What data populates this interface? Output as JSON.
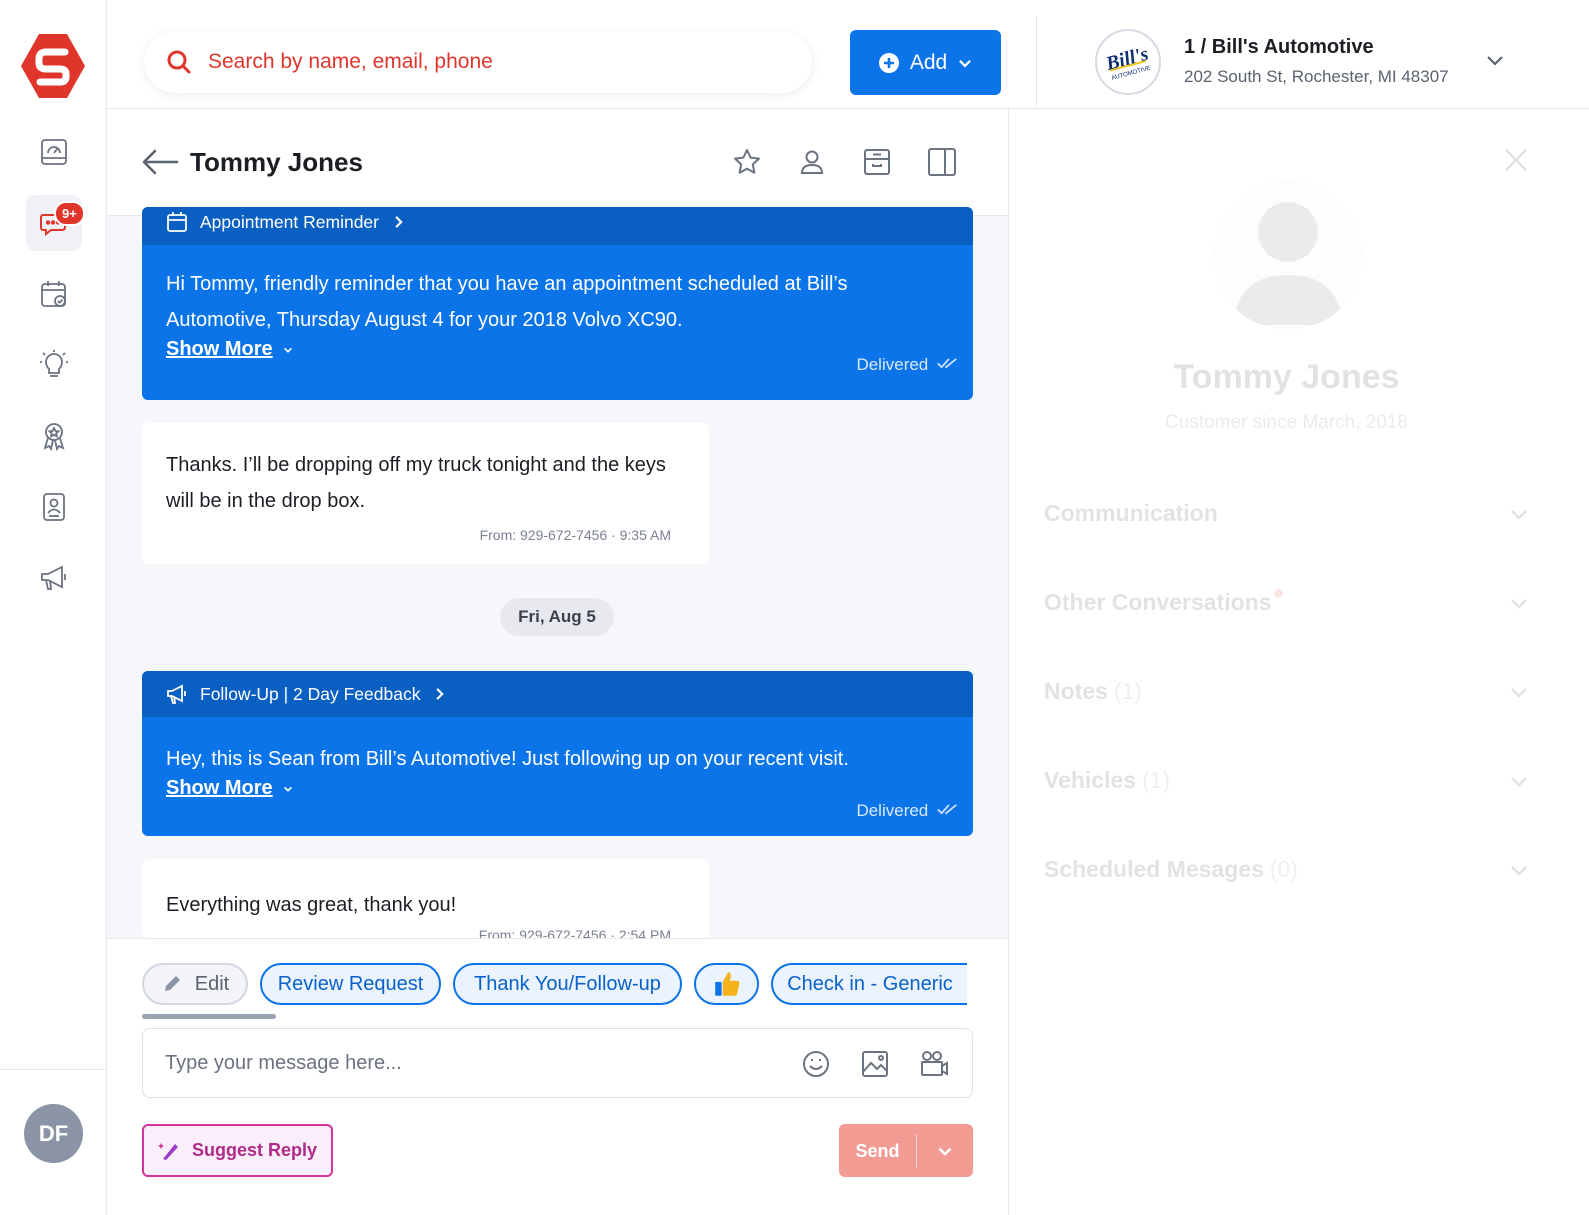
{
  "colors": {
    "brand_red": "#e0352b",
    "primary_blue": "#0a74e8",
    "label_blue": "#0a5fc2",
    "send_disabled": "#f29b93",
    "suggest_magenta": "#d3359d"
  },
  "rail": {
    "logo_icon": "s-logo-icon",
    "items": [
      {
        "name": "dashboard-icon"
      },
      {
        "name": "messages-icon",
        "badge": "9+",
        "active": true
      },
      {
        "name": "calendar-icon"
      },
      {
        "name": "insights-icon"
      },
      {
        "name": "rewards-icon"
      },
      {
        "name": "contacts-icon"
      },
      {
        "name": "campaigns-icon"
      }
    ],
    "avatar_initials": "DF"
  },
  "topbar": {
    "search_placeholder": "Search by name, email, phone",
    "add_label": "Add",
    "shop_name": "1 / Bill's Automotive",
    "shop_address": "202 South St, Rochester, MI 48307",
    "shop_logo_text": "Bill's",
    "shop_logo_sub": "AUTOMOTIVE"
  },
  "conversation": {
    "contact_name": "Tommy Jones",
    "messages": [
      {
        "type": "outgoing",
        "label": "Appointment Reminder",
        "text": "Hi Tommy, friendly reminder that you have an appointment scheduled at Bill’s Automotive, Thursday August 4 for your 2018 Volvo XC90.",
        "show_more": "Show More",
        "status": "Delivered"
      },
      {
        "type": "incoming",
        "text": "Thanks. I’ll be dropping off my truck tonight and the keys will be in the drop box.",
        "meta": "From: 929-672-7456 · 9:35 AM"
      },
      {
        "type": "outgoing",
        "label": "Follow-Up | 2 Day Feedback",
        "text": "Hey, this is Sean from Bill’s Automotive! Just following up on your recent visit.",
        "show_more": "Show More",
        "status": "Delivered"
      },
      {
        "type": "incoming",
        "text": "Everything was great, thank you!",
        "meta": "From: 929-672-7456 · 2:54 PM"
      }
    ],
    "date_separator": "Fri, Aug 5"
  },
  "quick_replies": {
    "edit_label": "Edit",
    "chips": [
      "Review Request",
      "Thank You/Follow-up",
      "Check in - Generic"
    ],
    "thumbs_icon": "thumbs-up-icon"
  },
  "composer": {
    "placeholder": "Type your message here...",
    "suggest_label": "Suggest Reply",
    "send_label": "Send"
  },
  "profile": {
    "name": "Tommy Jones",
    "since": "Customer since March, 2018",
    "sections": [
      {
        "label": "Communication",
        "count": ""
      },
      {
        "label": "Other Conversations",
        "count": "",
        "dot": true
      },
      {
        "label": "Notes",
        "count": "(1)"
      },
      {
        "label": "Vehicles",
        "count": "(1)"
      },
      {
        "label": "Scheduled Mesages",
        "count": "(0)"
      }
    ]
  }
}
